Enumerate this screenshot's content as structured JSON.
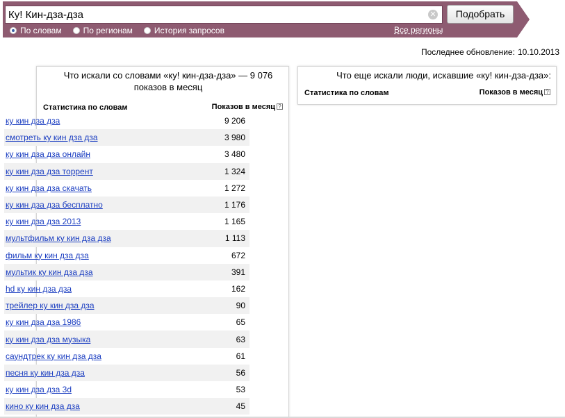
{
  "header": {
    "search_value": "Ку! Кин-дза-дза",
    "clear_glyph": "✕",
    "submit_label": "Подобрать",
    "modes": [
      {
        "label": "По словам",
        "checked": true
      },
      {
        "label": "По регионам",
        "checked": false
      },
      {
        "label": "История запросов",
        "checked": false
      }
    ],
    "regions_link": "Все регионы"
  },
  "last_update": {
    "label": "Последнее обновление:",
    "date": "10.10.2013"
  },
  "left_panel": {
    "title": "Что искали со словами «ку! кин-дза-дза» — 9 076 показов в месяц",
    "col_phrase": "Статистика по словам",
    "col_count": "Показов в месяц",
    "help_glyph": "?",
    "rows": [
      {
        "phrase": "ку кин дза дза",
        "count": "9 206"
      },
      {
        "phrase": "смотреть ку кин дза дза",
        "count": "3 980"
      },
      {
        "phrase": "ку кин дза дза онлайн",
        "count": "3 480"
      },
      {
        "phrase": "ку кин дза дза торрент",
        "count": "1 324"
      },
      {
        "phrase": "ку кин дза дза скачать",
        "count": "1 272"
      },
      {
        "phrase": "ку кин дза дза бесплатно",
        "count": "1 176"
      },
      {
        "phrase": "ку кин дза дза 2013",
        "count": "1 165"
      },
      {
        "phrase": "мультфильм ку кин дза дза",
        "count": "1 113"
      },
      {
        "phrase": "фильм ку кин дза дза",
        "count": "672"
      },
      {
        "phrase": "мультик ку кин дза дза",
        "count": "391"
      },
      {
        "phrase": "hd ку кин дза дза",
        "count": "162"
      },
      {
        "phrase": "трейлер ку кин дза дза",
        "count": "90"
      },
      {
        "phrase": "ку кин дза дза 1986",
        "count": "65"
      },
      {
        "phrase": "ку кин дза дза музыка",
        "count": "63"
      },
      {
        "phrase": "саундтрек ку кин дза дза",
        "count": "61"
      },
      {
        "phrase": "песня ку кин дза дза",
        "count": "56"
      },
      {
        "phrase": "ку кин дза дза 3d",
        "count": "53"
      },
      {
        "phrase": "кино ку кин дза дза",
        "count": "45"
      }
    ]
  },
  "right_panel": {
    "title": "Что еще искали люди, искавшие «ку! кин-дза-дза»:",
    "col_phrase": "Статистика по словам",
    "col_count": "Показов в месяц",
    "help_glyph": "?"
  }
}
